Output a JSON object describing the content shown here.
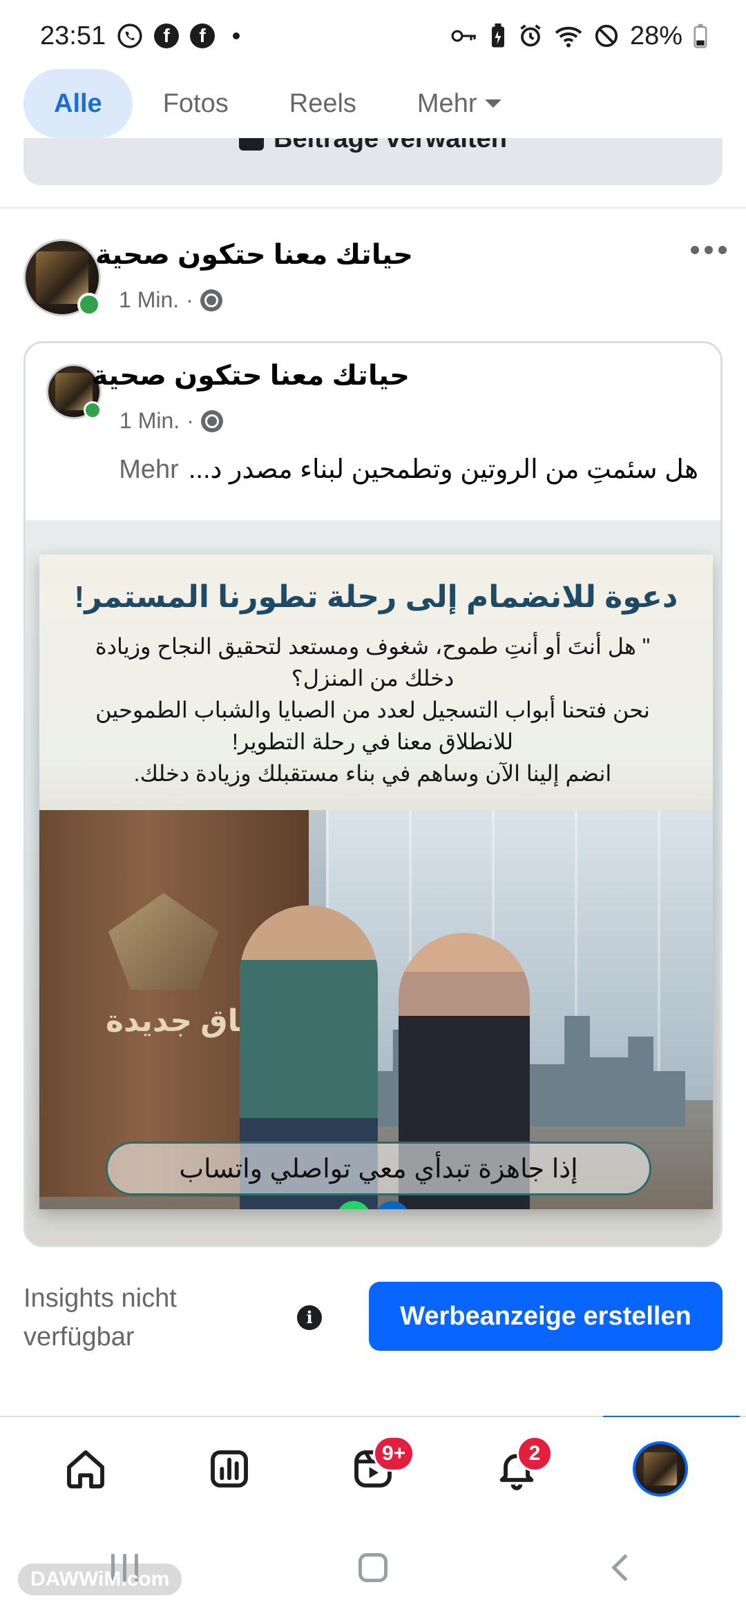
{
  "status_bar": {
    "time": "23:51",
    "battery": "28%",
    "left_icons": [
      "whatsapp-icon",
      "facebook-icon",
      "facebook-icon"
    ],
    "right_icons": [
      "key-icon",
      "battery-saver-icon",
      "alarm-icon",
      "wifi-icon",
      "do-not-disturb-icon",
      "battery-icon"
    ]
  },
  "tabs": [
    {
      "label": "Alle",
      "active": true
    },
    {
      "label": "Fotos",
      "active": false
    },
    {
      "label": "Reels",
      "active": false
    },
    {
      "label": "Mehr",
      "active": false
    }
  ],
  "manage_posts": {
    "label": "Beiträge verwalten"
  },
  "post": {
    "author": "حياتك معنا حتكون صحية",
    "time": "1 Min.",
    "separator": "·",
    "privacy_icon": "globe-icon"
  },
  "shared_post": {
    "author": "حياتك معنا حتكون صحية",
    "time": "1 Min.",
    "separator": "·",
    "text": "هل سئمتِ من الروتين وتطمحين لبناء مصدر د...",
    "more_label": "Mehr"
  },
  "ad_image": {
    "title": "دعوة للانضمام إلى رحلة تطورنا المستمر!",
    "lines": [
      "\" هل أنتَ أو أنتِ طموح، شغوف ومستعد لتحقيق النجاح وزيادة",
      "دخلك من المنزل؟",
      "نحن فتحنا أبواب التسجيل لعدد من الصبايا والشباب الطموحين",
      "للانطلاق معنا في رحلة التطوير!",
      "انضم إلينا الآن وساهم في بناء مستقبلك وزيادة دخلك."
    ],
    "wall_text": "آفاق جديدة",
    "cta": "إذا جاهزة تبدأي معي تواصلي واتساب",
    "social": [
      "whatsapp-icon",
      "linkedin-icon"
    ],
    "linkedin_letters": "in"
  },
  "insights": {
    "label": "Insights nicht verfügbar",
    "info_icon": "info-icon"
  },
  "promote_button": "Werbeanzeige erstellen",
  "bottom_nav": [
    {
      "name": "home-icon"
    },
    {
      "name": "insights-chart-icon"
    },
    {
      "name": "reels-icon",
      "badge": "9+"
    },
    {
      "name": "bell-icon",
      "badge": "2"
    },
    {
      "name": "profile-avatar"
    }
  ],
  "watermark": "DAWWiM.com",
  "colors": {
    "accent": "#0866ff",
    "tab_active_bg": "#dce9fb",
    "badge": "#e41e3f",
    "online": "#31a24c"
  }
}
